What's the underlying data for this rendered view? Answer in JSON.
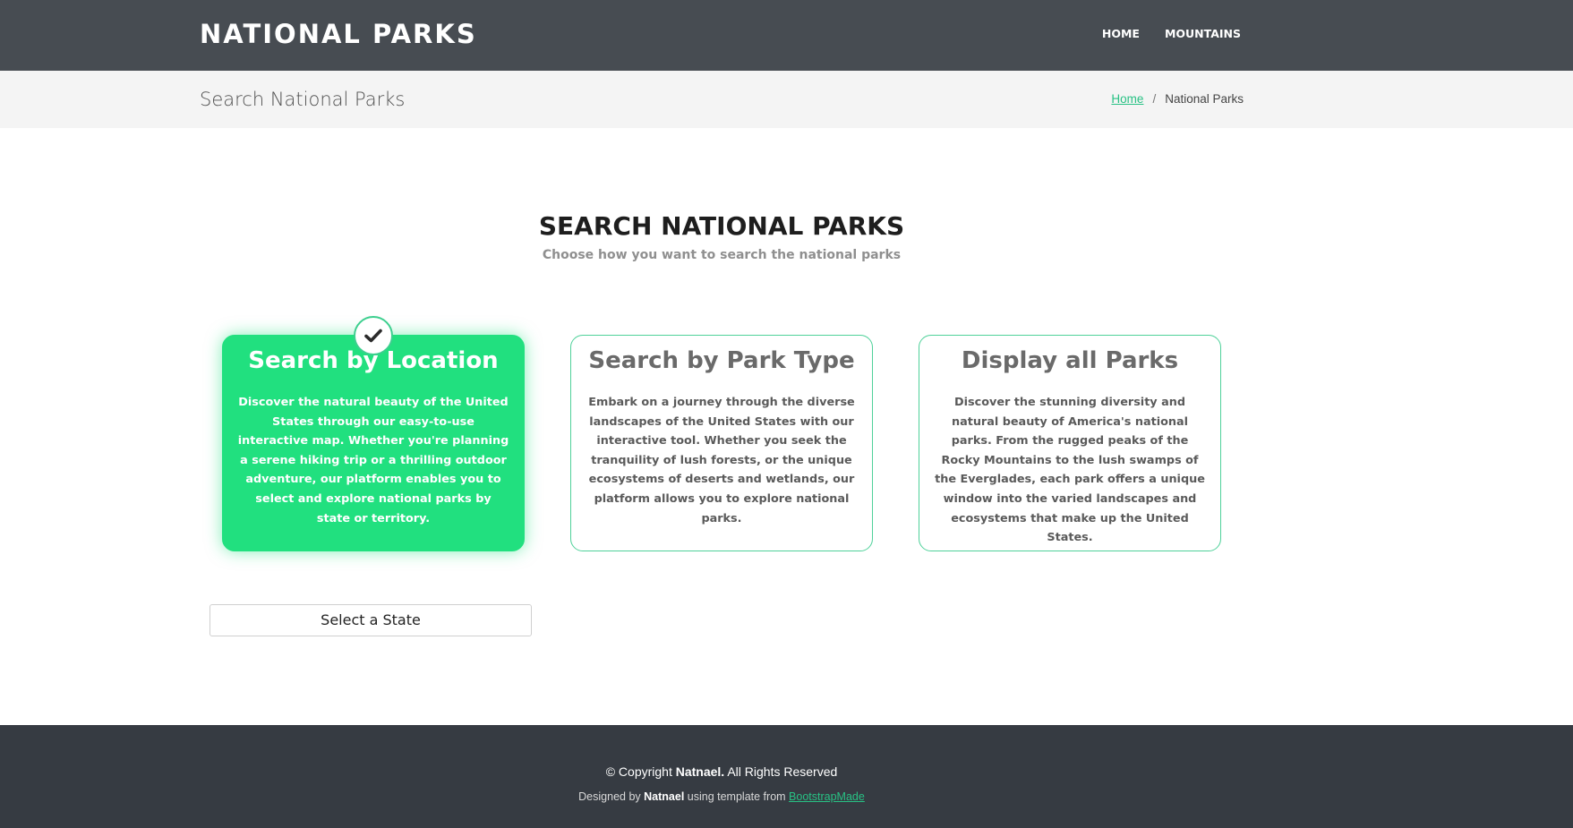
{
  "header": {
    "logo": "NATIONAL PARKS",
    "nav": [
      {
        "label": "HOME"
      },
      {
        "label": "MOUNTAINS"
      }
    ]
  },
  "breadcrumb_bar": {
    "title": "Search National Parks",
    "home": "Home",
    "separator": "/",
    "current": "National Parks"
  },
  "section": {
    "title": "SEARCH NATIONAL PARKS",
    "subtitle": "Choose how you want to search the national parks"
  },
  "cards": [
    {
      "title": "Search by Location",
      "description": "Discover the natural beauty of the United States through our easy-to-use interactive map. Whether you're planning a serene hiking trip or a thrilling outdoor adventure, our platform enables you to select and explore national parks by state or territory.",
      "selected": true
    },
    {
      "title": "Search by Park Type",
      "description": "Embark on a journey through the diverse landscapes of the United States with our interactive tool. Whether you seek the tranquility of lush forests, or the unique ecosystems of deserts and wetlands, our platform allows you to explore national parks.",
      "selected": false
    },
    {
      "title": "Display all Parks",
      "description": "Discover the stunning diversity and natural beauty of America's national parks. From the rugged peaks of the Rocky Mountains to the lush swamps of the Everglades, each park offers a unique window into the varied landscapes and ecosystems that make up the United States.",
      "selected": false
    }
  ],
  "state_select": {
    "label": "Select a State"
  },
  "footer": {
    "copyright_prefix": "© Copyright",
    "copyright_name": "Natnael.",
    "copyright_suffix": "All Rights Reserved",
    "designed_prefix": "Designed by",
    "designed_name": "Natnael",
    "designed_middle": "using template from",
    "designed_link": "BootstrapMade"
  },
  "colors": {
    "accent": "#21e07f",
    "link": "#28c184",
    "header_bg": "#474c52",
    "footer_bg": "#363b42"
  },
  "icons": {
    "selected_marker": "check-icon"
  }
}
